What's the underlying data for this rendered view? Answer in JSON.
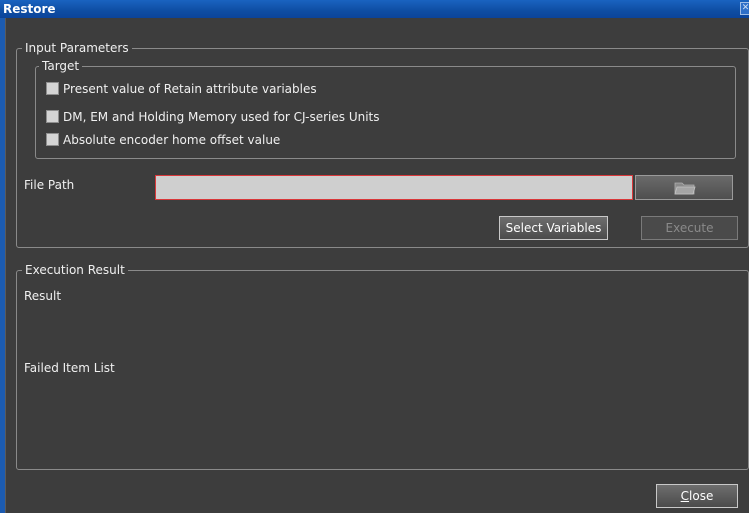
{
  "window": {
    "title": "Restore",
    "close_glyph": "✕"
  },
  "input_parameters": {
    "legend": "Input Parameters",
    "target": {
      "legend": "Target",
      "options": [
        {
          "label": "Present value of Retain attribute variables",
          "checked": false
        },
        {
          "label": "DM, EM and Holding Memory used for CJ-series Units",
          "checked": false
        },
        {
          "label": "Absolute encoder home offset value",
          "checked": false
        }
      ]
    },
    "file_path": {
      "label": "File Path",
      "value": "",
      "browse_icon": "folder-icon"
    },
    "select_variables_label": "Select Variables",
    "execute_label": "Execute"
  },
  "execution_result": {
    "legend": "Execution Result",
    "result_label": "Result",
    "failed_item_list_label": "Failed Item List"
  },
  "footer": {
    "close_label_first": "C",
    "close_label_rest": "lose"
  },
  "colors": {
    "window_bg": "#3d3d3d",
    "titlebar": "#0e4da3",
    "required_border": "#d9383a"
  }
}
